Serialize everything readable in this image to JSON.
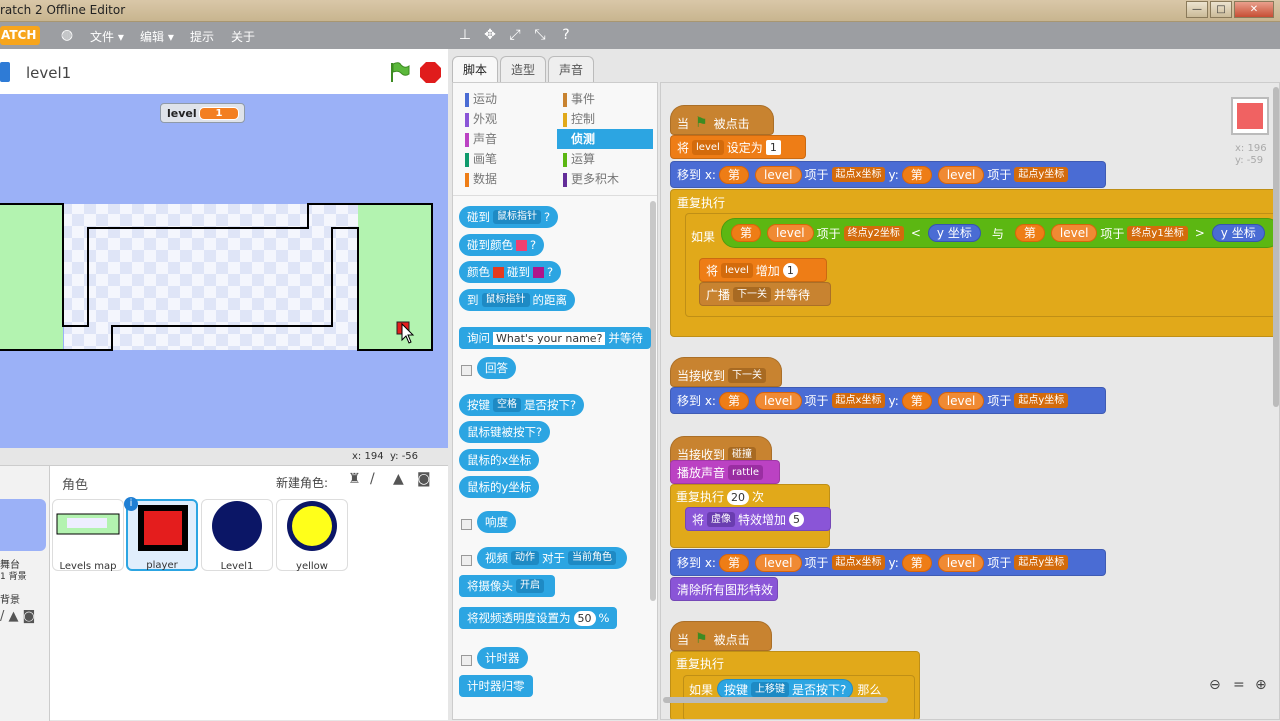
{
  "window": {
    "title": "ratch 2 Offline Editor",
    "buttons": [
      "—",
      "□",
      "✕"
    ]
  },
  "menubar": {
    "logo": "ATCH",
    "items": [
      "文件 ▾",
      "编辑 ▾",
      "提示",
      "关于"
    ]
  },
  "stage": {
    "sprite_name": "level1",
    "monitor_label": "level",
    "monitor_value": "1",
    "coord_x_label": "x:",
    "coord_x": "194",
    "coord_y_label": "y:",
    "coord_y": "-56"
  },
  "sprite_pane": {
    "title": "角色",
    "new_sprite": "新建角色:",
    "stage_label": "舞台",
    "stage_bg": "1 背景",
    "new_bg": "背景",
    "sprites": [
      {
        "name": "Levels map"
      },
      {
        "name": "player"
      },
      {
        "name": "Level1"
      },
      {
        "name": "yellow"
      }
    ]
  },
  "tabs": [
    "脚本",
    "造型",
    "声音"
  ],
  "categories": {
    "left": [
      "运动",
      "外观",
      "声音",
      "画笔",
      "数据"
    ],
    "right": [
      "事件",
      "控制",
      "侦测",
      "运算",
      "更多积木"
    ]
  },
  "palette": {
    "touching": "碰到",
    "mouse_ptr": "鼠标指针",
    "q": "?",
    "touch_color": "碰到颜色",
    "color": "颜色",
    "touch2": "碰到",
    "to": "到",
    "distance": "的距离",
    "ask": "询问",
    "ask_default": "What's your name?",
    "ask_wait": "并等待",
    "answer": "回答",
    "key": "按键",
    "space": "空格",
    "pressed": "是否按下?",
    "mouse_down": "鼠标键被按下?",
    "mouse_x": "鼠标的x坐标",
    "mouse_y": "鼠标的y坐标",
    "loudness": "响度",
    "video": "视频",
    "motion": "动作",
    "on": "对于",
    "cur_sprite": "当前角色",
    "turn_video": "将摄像头",
    "open": "开启",
    "set_trans": "将视频透明度设置为",
    "trans_val": "50",
    "pct": "%",
    "timer": "计时器",
    "reset_timer": "计时器归零"
  },
  "scripts": {
    "when": "当",
    "clicked": "被点击",
    "set": "将",
    "level": "level",
    "set_to": "设定为",
    "one": "1",
    "goto": "移到 x:",
    "item_of": "第",
    "item": "项于",
    "startx": "起点x坐标",
    "starty": "起点y坐标",
    "y": "y:",
    "forever": "重复执行",
    "if": "如果",
    "endy2": "终点y2坐标",
    "lt": "<",
    "ypos": "y 坐标",
    "and": "与",
    "endy1": "终点y1坐标",
    "gt": ">",
    "ypos2": "y 坐标",
    "change": "增加",
    "bcast_wait": "广播",
    "next": "下一关",
    "and_wait": "并等待",
    "recv": "当接收到",
    "recv2": "碰撞",
    "play": "播放声音",
    "rattle": "rattle",
    "repeat": "重复执行",
    "twenty": "20",
    "times": "次",
    "effect": "虚像",
    "effect_change": "特效增加",
    "five": "5",
    "clear": "清除所有图形特效",
    "up": "上移键",
    "then": "那么",
    "mouse_x": "x: 196",
    "mouse_y": "y: -59"
  },
  "colors": {
    "stage_bg": "#9bb1f7",
    "floor": "#b3f3b0",
    "sensing": "#2ca5e2",
    "events": "#c88330",
    "control": "#e1a91a"
  }
}
